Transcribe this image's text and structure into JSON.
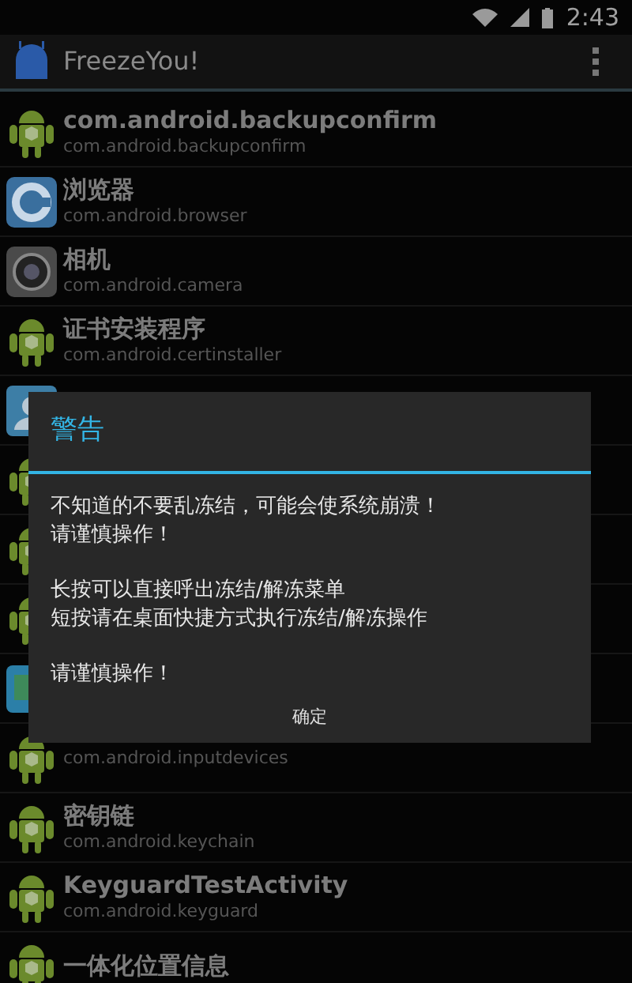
{
  "status_bar": {
    "time": "2:43"
  },
  "action_bar": {
    "title": "FreezeYou!"
  },
  "apps": [
    {
      "kind": "android",
      "title": "com.android.backupconfirm",
      "package": "com.android.backupconfirm"
    },
    {
      "kind": "browser",
      "title": "浏览器",
      "package": "com.android.browser"
    },
    {
      "kind": "camera",
      "title": "相机",
      "package": "com.android.camera"
    },
    {
      "kind": "android",
      "title": "证书安装程序",
      "package": "com.android.certinstaller"
    },
    {
      "kind": "contacts"
    },
    {
      "kind": "android"
    },
    {
      "kind": "android"
    },
    {
      "kind": "android"
    },
    {
      "kind": "screen"
    },
    {
      "kind": "android",
      "package": "com.android.inputdevices"
    },
    {
      "kind": "android",
      "title": "密钥链",
      "package": "com.android.keychain"
    },
    {
      "kind": "android",
      "title": "KeyguardTestActivity",
      "package": "com.android.keyguard"
    },
    {
      "kind": "android",
      "title": "一体化位置信息"
    }
  ],
  "dialog": {
    "title": "警告",
    "paragraphs": [
      [
        "不知道的不要乱冻结，可能会使系统崩溃！",
        "请谨慎操作！"
      ],
      [
        "长按可以直接呼出冻结/解冻菜单",
        "短按请在桌面快捷方式执行冻结/解冻操作"
      ],
      [
        "请谨慎操作！"
      ]
    ],
    "button": "确定"
  }
}
